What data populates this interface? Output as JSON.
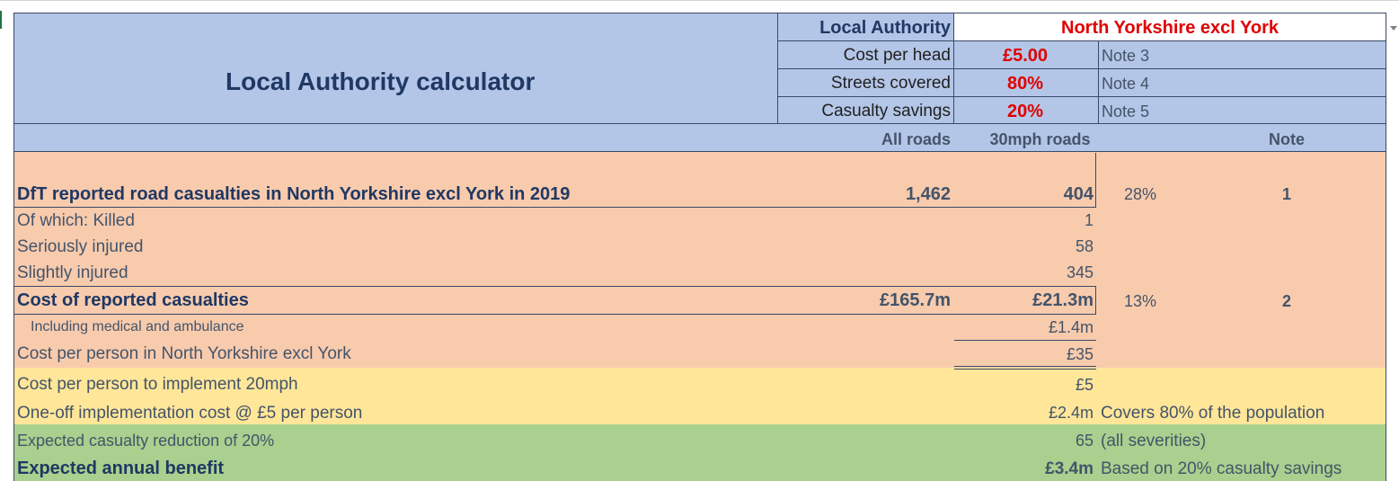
{
  "header": {
    "title": "Local Authority calculator",
    "inputs": [
      {
        "label": "Local Authority",
        "value": "North Yorkshire excl York",
        "note": ""
      },
      {
        "label": "Cost per head",
        "value": "£5.00",
        "note": "Note 3"
      },
      {
        "label": "Streets covered",
        "value": "80%",
        "note": "Note 4"
      },
      {
        "label": "Casualty savings",
        "value": "20%",
        "note": "Note 5"
      }
    ],
    "dropdown_icon": "dropdown-arrow-icon"
  },
  "columns": {
    "all_roads": "All roads",
    "mph30_roads": "30mph roads",
    "note": "Note"
  },
  "rows": {
    "reported": {
      "label": "DfT reported road casualties in North Yorkshire excl York in 2019",
      "all_roads": "1,462",
      "mph30": "404",
      "pct": "28%",
      "note": "1"
    },
    "killed": {
      "label": "Of which:  Killed",
      "mph30": "1"
    },
    "seriously": {
      "label": "Seriously injured",
      "mph30": "58"
    },
    "slightly": {
      "label": "Slightly injured",
      "mph30": "345"
    },
    "cost": {
      "label": "Cost of reported casualties",
      "all_roads": "£165.7m",
      "mph30": "£21.3m",
      "pct": "13%",
      "note": "2"
    },
    "medical": {
      "label": "Including medical and ambulance",
      "mph30": "£1.4m"
    },
    "per_person": {
      "label": "Cost per person in North Yorkshire excl York",
      "mph30": "£35"
    },
    "implement": {
      "label": "Cost per person to implement 20mph",
      "mph30": "£5"
    },
    "one_off": {
      "label": "One-off implementation cost @ £5 per person",
      "mph30": "£2.4m",
      "comment": "Covers 80% of the population"
    },
    "reduction": {
      "label": "Expected casualty reduction of 20%",
      "mph30": "65",
      "comment": "(all severities)"
    },
    "benefit": {
      "label": "Expected annual benefit",
      "mph30": "£3.4m",
      "comment": "Based on 20% casualty savings"
    }
  },
  "colors": {
    "header_blue": "#b4c6e7",
    "peach": "#f8cbad",
    "yellow": "#ffe699",
    "green": "#a9d08e",
    "input_red": "#e00000",
    "title_navy": "#1f3864"
  }
}
